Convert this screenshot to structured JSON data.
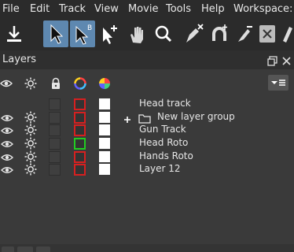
{
  "menu": {
    "file": "File",
    "edit": "Edit",
    "track": "Track",
    "view": "View",
    "movie": "Movie",
    "tools": "Tools",
    "help": "Help",
    "workspace": "Workspace: Cl"
  },
  "toolbar": {
    "items": [
      "download-icon",
      "select-arrow-icon",
      "select-b-arrow-icon",
      "add-point-arrow-icon",
      "hand-icon",
      "magnify-icon",
      "pen-x-icon",
      "magnet-icon",
      "brush-icon",
      "clear-x-icon",
      "knife-icon"
    ],
    "active": [
      "select-arrow-icon",
      "select-b-arrow-icon"
    ]
  },
  "panel": {
    "title": "Layers"
  },
  "columns": [
    "eye-icon",
    "sun-icon",
    "lock-icon",
    "color-wheel-outline-icon",
    "color-wheel-filled-icon"
  ],
  "layers": [
    {
      "label": "Head  track",
      "visible": false,
      "color": "#d62020",
      "kind": "layer"
    },
    {
      "label": "New layer group",
      "visible": true,
      "color": "#d62020",
      "kind": "group"
    },
    {
      "label": "Gun Track",
      "visible": true,
      "color": "#d62020",
      "kind": "layer"
    },
    {
      "label": "Head Roto",
      "visible": true,
      "color": "#22cc22",
      "kind": "layer"
    },
    {
      "label": "Hands Roto",
      "visible": true,
      "color": "#d62020",
      "kind": "layer"
    },
    {
      "label": "Layer 12",
      "visible": true,
      "color": "#d62020",
      "kind": "layer"
    }
  ],
  "colors": {
    "accent": "#5e88b0",
    "red": "#d62020",
    "green": "#22cc22"
  }
}
